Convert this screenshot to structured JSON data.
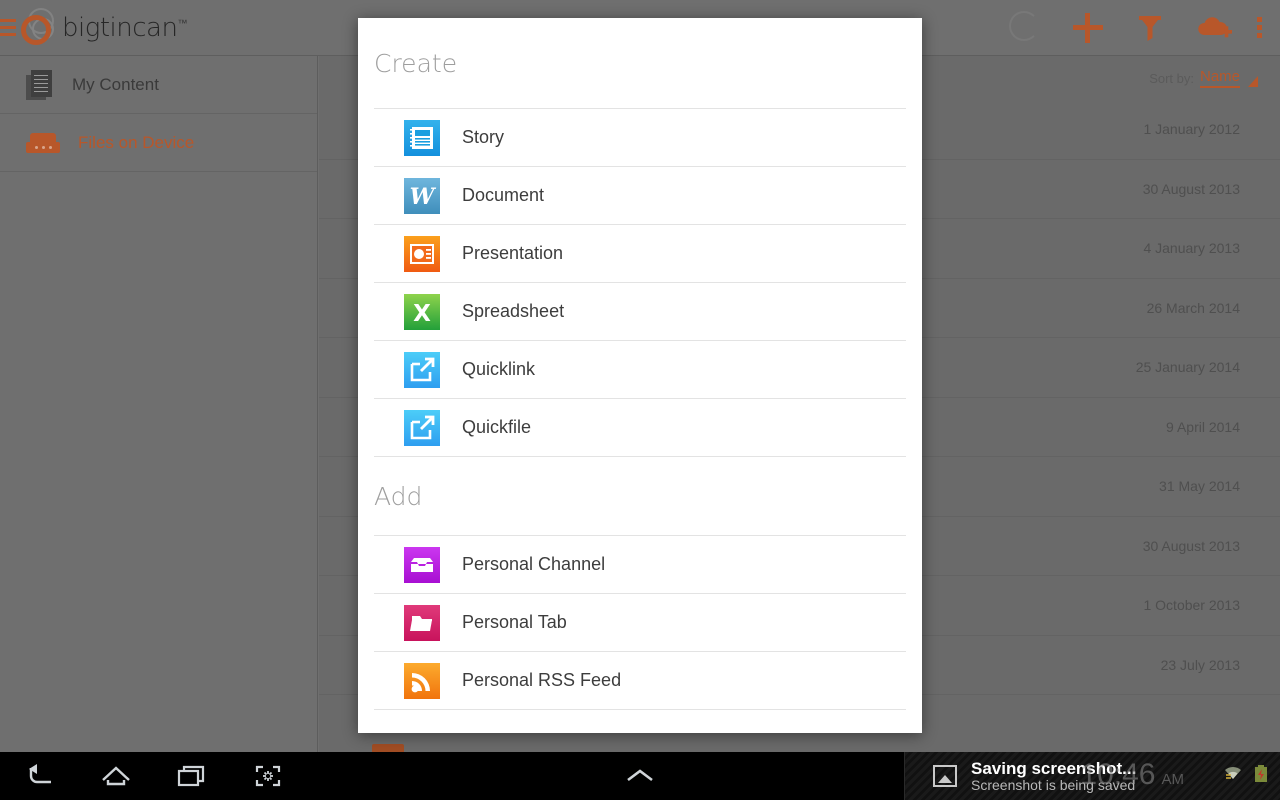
{
  "app": {
    "brand": "bigtincan",
    "brand_tm": "™",
    "accent": "#b8572a"
  },
  "topbar": {
    "menu_icon": "hamburger-icon",
    "actions": [
      {
        "name": "loading-spinner-icon",
        "label": "Loading"
      },
      {
        "name": "add-icon",
        "label": "Add"
      },
      {
        "name": "filter-funnel-icon",
        "label": "Filter"
      },
      {
        "name": "cloud-upload-icon",
        "label": "Upload to cloud"
      },
      {
        "name": "overflow-menu-icon",
        "label": "More options"
      }
    ]
  },
  "sidebar": {
    "items": [
      {
        "label": "My Content",
        "icon": "documents-icon",
        "active": false
      },
      {
        "label": "Files on Device",
        "icon": "hard-drive-icon",
        "active": true
      }
    ]
  },
  "content": {
    "sort": {
      "label": "Sort by:",
      "value": "Name",
      "caret_icon": "sort-caret-icon"
    },
    "rows": [
      {
        "date": "1 January 2012"
      },
      {
        "date": "30 August 2013"
      },
      {
        "date": "4 January 2013"
      },
      {
        "date": "26 March 2014"
      },
      {
        "date": "25 January 2014"
      },
      {
        "date": "9 April 2014"
      },
      {
        "date": "31 May 2014"
      },
      {
        "date": "30 August 2013"
      },
      {
        "date": "1 October 2013"
      },
      {
        "date": "23 July 2013"
      }
    ]
  },
  "dialog": {
    "sections": [
      {
        "title": "Create",
        "items": [
          {
            "label": "Story",
            "icon": "story-icon",
            "color": "#1a9fe0"
          },
          {
            "label": "Document",
            "icon": "word-document-icon",
            "color": "#4a9cc9"
          },
          {
            "label": "Presentation",
            "icon": "presentation-icon",
            "color": "#f26a1b"
          },
          {
            "label": "Spreadsheet",
            "icon": "spreadsheet-icon",
            "color": "#4cb847"
          },
          {
            "label": "Quicklink",
            "icon": "quicklink-icon",
            "color": "#2ab6f5"
          },
          {
            "label": "Quickfile",
            "icon": "quickfile-icon",
            "color": "#2ab6f5"
          }
        ]
      },
      {
        "title": "Add",
        "items": [
          {
            "label": "Personal Channel",
            "icon": "channel-inbox-icon",
            "color": "#b922e0"
          },
          {
            "label": "Personal Tab",
            "icon": "folder-icon",
            "color": "#d6256b"
          },
          {
            "label": "Personal RSS Feed",
            "icon": "rss-feed-icon",
            "color": "#f78f1e"
          }
        ]
      }
    ]
  },
  "navbar": {
    "buttons": [
      {
        "name": "back-button",
        "label": "Back"
      },
      {
        "name": "home-button",
        "label": "Home"
      },
      {
        "name": "recents-button",
        "label": "Recent apps"
      },
      {
        "name": "screenshot-button",
        "label": "Screenshot"
      }
    ],
    "expand": {
      "name": "expand-notifications-caret-icon",
      "label": "Expand"
    },
    "notification": {
      "icon": "image-icon",
      "title": "Saving screenshot...",
      "subtitle": "Screenshot is being saved"
    },
    "status": {
      "time": "10:46",
      "ampm": "AM",
      "wifi_icon": "wifi-icon",
      "battery_icon": "battery-charging-icon"
    }
  }
}
